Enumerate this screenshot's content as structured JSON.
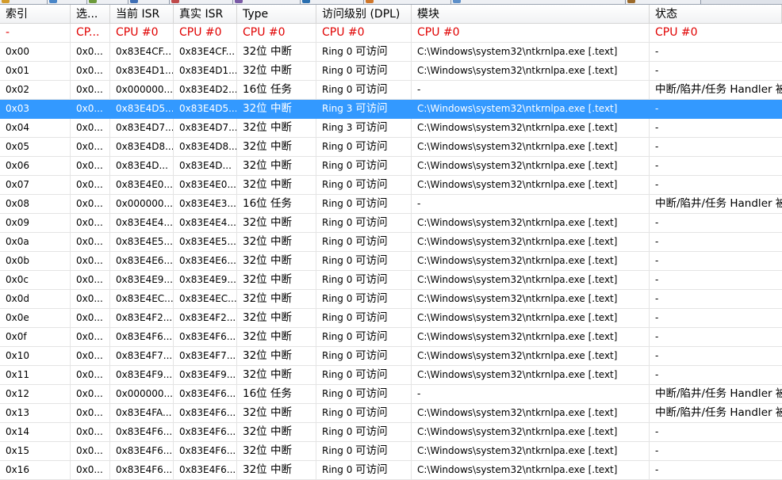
{
  "window": {
    "accent_color": "#3399ff",
    "cpu_row_color": "#e00000",
    "selected_text_color": "#ffffff"
  },
  "tabs": [
    {
      "icon": "process-icon",
      "color": "#d39b2c"
    },
    {
      "icon": "module-icon",
      "color": "#4a86c8"
    },
    {
      "icon": "kernel-icon",
      "color": "#6c9a3a"
    },
    {
      "icon": "hook-icon",
      "color": "#3f6fb5"
    },
    {
      "icon": "network-icon",
      "color": "#c04a4a"
    },
    {
      "icon": "registry-icon",
      "color": "#7a5aa6"
    },
    {
      "icon": "file-icon",
      "color": "#2a6fb0"
    },
    {
      "icon": "startup-icon",
      "color": "#d0772a"
    },
    {
      "icon": "settings-icon",
      "color": "#5d8fc9"
    },
    {
      "icon": "tools-icon",
      "color": "#9c6a2a"
    }
  ],
  "columns": [
    "索引",
    "选...",
    "当前 ISR",
    "真实 ISR",
    "Type",
    "访问级别 (DPL)",
    "模块",
    "状态"
  ],
  "cpu_row": [
    "-",
    "CP...",
    "CPU #0",
    "CPU #0",
    "CPU #0",
    "CPU #0",
    "CPU #0",
    "CPU #0"
  ],
  "selected_index": "0x03",
  "rows": [
    {
      "index": "0x00",
      "selector": "0x0...",
      "current_isr": "0x83E4CF...",
      "real_isr": "0x83E4CF...",
      "type": "32位 中断",
      "ring": "Ring 0",
      "access": "可访问",
      "module": "C:\\Windows\\system32\\ntkrnlpa.exe [.text]",
      "status": "-"
    },
    {
      "index": "0x01",
      "selector": "0x0...",
      "current_isr": "0x83E4D1...",
      "real_isr": "0x83E4D1...",
      "type": "32位 中断",
      "ring": "Ring 0",
      "access": "可访问",
      "module": "C:\\Windows\\system32\\ntkrnlpa.exe [.text]",
      "status": "-"
    },
    {
      "index": "0x02",
      "selector": "0x0...",
      "current_isr": "0x000000...",
      "real_isr": "0x83E4D2...",
      "type": "16位 任务",
      "ring": "Ring 0",
      "access": "可访问",
      "module": "-",
      "status": "中断/陷井/任务 Handler 被"
    },
    {
      "index": "0x03",
      "selector": "0x0...",
      "current_isr": "0x83E4D5...",
      "real_isr": "0x83E4D5...",
      "type": "32位 中断",
      "ring": "Ring 3",
      "access": "可访问",
      "module": "C:\\Windows\\system32\\ntkrnlpa.exe [.text]",
      "status": "-"
    },
    {
      "index": "0x04",
      "selector": "0x0...",
      "current_isr": "0x83E4D7...",
      "real_isr": "0x83E4D7...",
      "type": "32位 中断",
      "ring": "Ring 3",
      "access": "可访问",
      "module": "C:\\Windows\\system32\\ntkrnlpa.exe [.text]",
      "status": "-"
    },
    {
      "index": "0x05",
      "selector": "0x0...",
      "current_isr": "0x83E4D8...",
      "real_isr": "0x83E4D8...",
      "type": "32位 中断",
      "ring": "Ring 0",
      "access": "可访问",
      "module": "C:\\Windows\\system32\\ntkrnlpa.exe [.text]",
      "status": "-"
    },
    {
      "index": "0x06",
      "selector": "0x0...",
      "current_isr": "0x83E4D...",
      "real_isr": "0x83E4D...",
      "type": "32位 中断",
      "ring": "Ring 0",
      "access": "可访问",
      "module": "C:\\Windows\\system32\\ntkrnlpa.exe [.text]",
      "status": "-"
    },
    {
      "index": "0x07",
      "selector": "0x0...",
      "current_isr": "0x83E4E0...",
      "real_isr": "0x83E4E0...",
      "type": "32位 中断",
      "ring": "Ring 0",
      "access": "可访问",
      "module": "C:\\Windows\\system32\\ntkrnlpa.exe [.text]",
      "status": "-"
    },
    {
      "index": "0x08",
      "selector": "0x0...",
      "current_isr": "0x000000...",
      "real_isr": "0x83E4E3...",
      "type": "16位 任务",
      "ring": "Ring 0",
      "access": "可访问",
      "module": "-",
      "status": "中断/陷井/任务 Handler 被"
    },
    {
      "index": "0x09",
      "selector": "0x0...",
      "current_isr": "0x83E4E4...",
      "real_isr": "0x83E4E4...",
      "type": "32位 中断",
      "ring": "Ring 0",
      "access": "可访问",
      "module": "C:\\Windows\\system32\\ntkrnlpa.exe [.text]",
      "status": "-"
    },
    {
      "index": "0x0a",
      "selector": "0x0...",
      "current_isr": "0x83E4E5...",
      "real_isr": "0x83E4E5...",
      "type": "32位 中断",
      "ring": "Ring 0",
      "access": "可访问",
      "module": "C:\\Windows\\system32\\ntkrnlpa.exe [.text]",
      "status": "-"
    },
    {
      "index": "0x0b",
      "selector": "0x0...",
      "current_isr": "0x83E4E6...",
      "real_isr": "0x83E4E6...",
      "type": "32位 中断",
      "ring": "Ring 0",
      "access": "可访问",
      "module": "C:\\Windows\\system32\\ntkrnlpa.exe [.text]",
      "status": "-"
    },
    {
      "index": "0x0c",
      "selector": "0x0...",
      "current_isr": "0x83E4E9...",
      "real_isr": "0x83E4E9...",
      "type": "32位 中断",
      "ring": "Ring 0",
      "access": "可访问",
      "module": "C:\\Windows\\system32\\ntkrnlpa.exe [.text]",
      "status": "-"
    },
    {
      "index": "0x0d",
      "selector": "0x0...",
      "current_isr": "0x83E4EC...",
      "real_isr": "0x83E4EC...",
      "type": "32位 中断",
      "ring": "Ring 0",
      "access": "可访问",
      "module": "C:\\Windows\\system32\\ntkrnlpa.exe [.text]",
      "status": "-"
    },
    {
      "index": "0x0e",
      "selector": "0x0...",
      "current_isr": "0x83E4F2...",
      "real_isr": "0x83E4F2...",
      "type": "32位 中断",
      "ring": "Ring 0",
      "access": "可访问",
      "module": "C:\\Windows\\system32\\ntkrnlpa.exe [.text]",
      "status": "-"
    },
    {
      "index": "0x0f",
      "selector": "0x0...",
      "current_isr": "0x83E4F6...",
      "real_isr": "0x83E4F6...",
      "type": "32位 中断",
      "ring": "Ring 0",
      "access": "可访问",
      "module": "C:\\Windows\\system32\\ntkrnlpa.exe [.text]",
      "status": "-"
    },
    {
      "index": "0x10",
      "selector": "0x0...",
      "current_isr": "0x83E4F7...",
      "real_isr": "0x83E4F7...",
      "type": "32位 中断",
      "ring": "Ring 0",
      "access": "可访问",
      "module": "C:\\Windows\\system32\\ntkrnlpa.exe [.text]",
      "status": "-"
    },
    {
      "index": "0x11",
      "selector": "0x0...",
      "current_isr": "0x83E4F9...",
      "real_isr": "0x83E4F9...",
      "type": "32位 中断",
      "ring": "Ring 0",
      "access": "可访问",
      "module": "C:\\Windows\\system32\\ntkrnlpa.exe [.text]",
      "status": "-"
    },
    {
      "index": "0x12",
      "selector": "0x0...",
      "current_isr": "0x000000...",
      "real_isr": "0x83E4F6...",
      "type": "16位 任务",
      "ring": "Ring 0",
      "access": "可访问",
      "module": "-",
      "status": "中断/陷井/任务 Handler 被"
    },
    {
      "index": "0x13",
      "selector": "0x0...",
      "current_isr": "0x83E4FA...",
      "real_isr": "0x83E4F6...",
      "type": "32位 中断",
      "ring": "Ring 0",
      "access": "可访问",
      "module": "C:\\Windows\\system32\\ntkrnlpa.exe [.text]",
      "status": "中断/陷井/任务 Handler 被"
    },
    {
      "index": "0x14",
      "selector": "0x0...",
      "current_isr": "0x83E4F6...",
      "real_isr": "0x83E4F6...",
      "type": "32位 中断",
      "ring": "Ring 0",
      "access": "可访问",
      "module": "C:\\Windows\\system32\\ntkrnlpa.exe [.text]",
      "status": "-"
    },
    {
      "index": "0x15",
      "selector": "0x0...",
      "current_isr": "0x83E4F6...",
      "real_isr": "0x83E4F6...",
      "type": "32位 中断",
      "ring": "Ring 0",
      "access": "可访问",
      "module": "C:\\Windows\\system32\\ntkrnlpa.exe [.text]",
      "status": "-"
    },
    {
      "index": "0x16",
      "selector": "0x0...",
      "current_isr": "0x83E4F6...",
      "real_isr": "0x83E4F6...",
      "type": "32位 中断",
      "ring": "Ring 0",
      "access": "可访问",
      "module": "C:\\Windows\\system32\\ntkrnlpa.exe [.text]",
      "status": "-"
    }
  ]
}
